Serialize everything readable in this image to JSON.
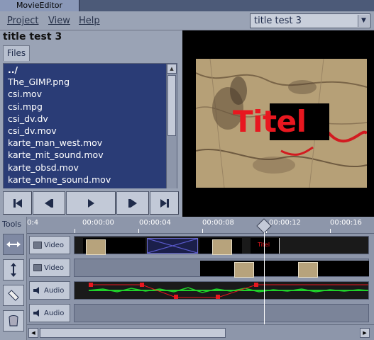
{
  "window": {
    "title": "MovieEditor"
  },
  "menu": {
    "project": "Project",
    "view": "View",
    "help": "Help"
  },
  "project_select": {
    "value": "title test 3"
  },
  "project": {
    "title": "title test 3"
  },
  "files_tab": {
    "label": "Files"
  },
  "files": [
    "../",
    "The_GIMP.png",
    "csi.mov",
    "csi.mpg",
    "csi_dv.dv",
    "csi_dv.mov",
    "karte_man_west.mov",
    "karte_mit_sound.mov",
    "karte_obsd.mov",
    "karte_ohne_sound.mov"
  ],
  "preview": {
    "overlay_text": "Titel"
  },
  "tools": {
    "label": "Tools"
  },
  "ruler": {
    "labels": [
      "0:4",
      "00:00:00",
      "00:00:04",
      "00:00:08",
      "00:00:12",
      "00:00:16"
    ]
  },
  "tracks": [
    {
      "label": "Video",
      "type": "video"
    },
    {
      "label": "Video",
      "type": "video"
    },
    {
      "label": "Audio",
      "type": "audio"
    },
    {
      "label": "Audio",
      "type": "audio"
    }
  ],
  "clip_title_label": "Titel",
  "colors": {
    "selection": "#2a3c76",
    "accent": "#e8171f",
    "panel": "#9aa3b5"
  }
}
